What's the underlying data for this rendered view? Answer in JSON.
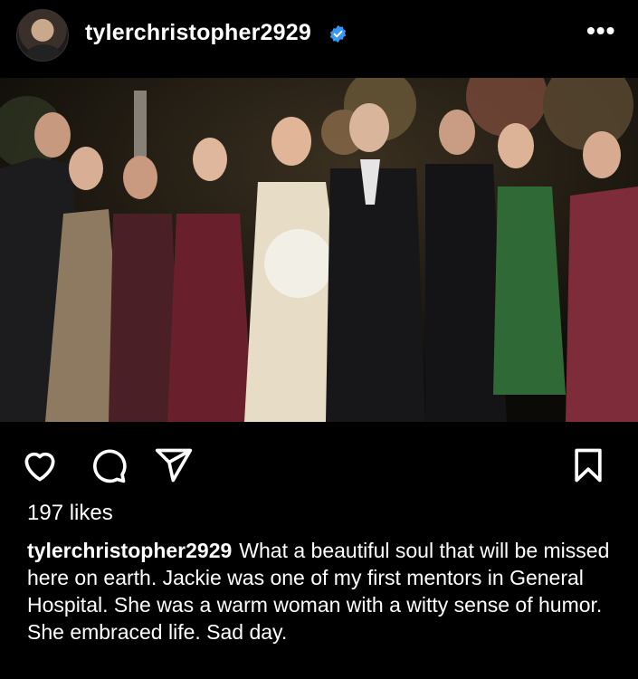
{
  "post": {
    "username": "tylerchristopher2929",
    "verified": true,
    "more_icon": "ellipsis-icon",
    "likes": "197 likes",
    "caption_user": "tylerchristopher2929",
    "caption_text": "What a beautiful soul that will be missed here on earth.  Jackie was one of my first mentors in General Hospital.  She was a warm woman with a witty sense of humor.  She embraced life.  Sad day.",
    "photo_subject": "group-wedding-photo"
  },
  "actions": {
    "like_icon": "heart-icon",
    "comment_icon": "comment-icon",
    "share_icon": "send-icon",
    "save_icon": "bookmark-icon"
  },
  "colors": {
    "background": "#000000",
    "verified": "#3897f0",
    "text": "#ffffff"
  }
}
